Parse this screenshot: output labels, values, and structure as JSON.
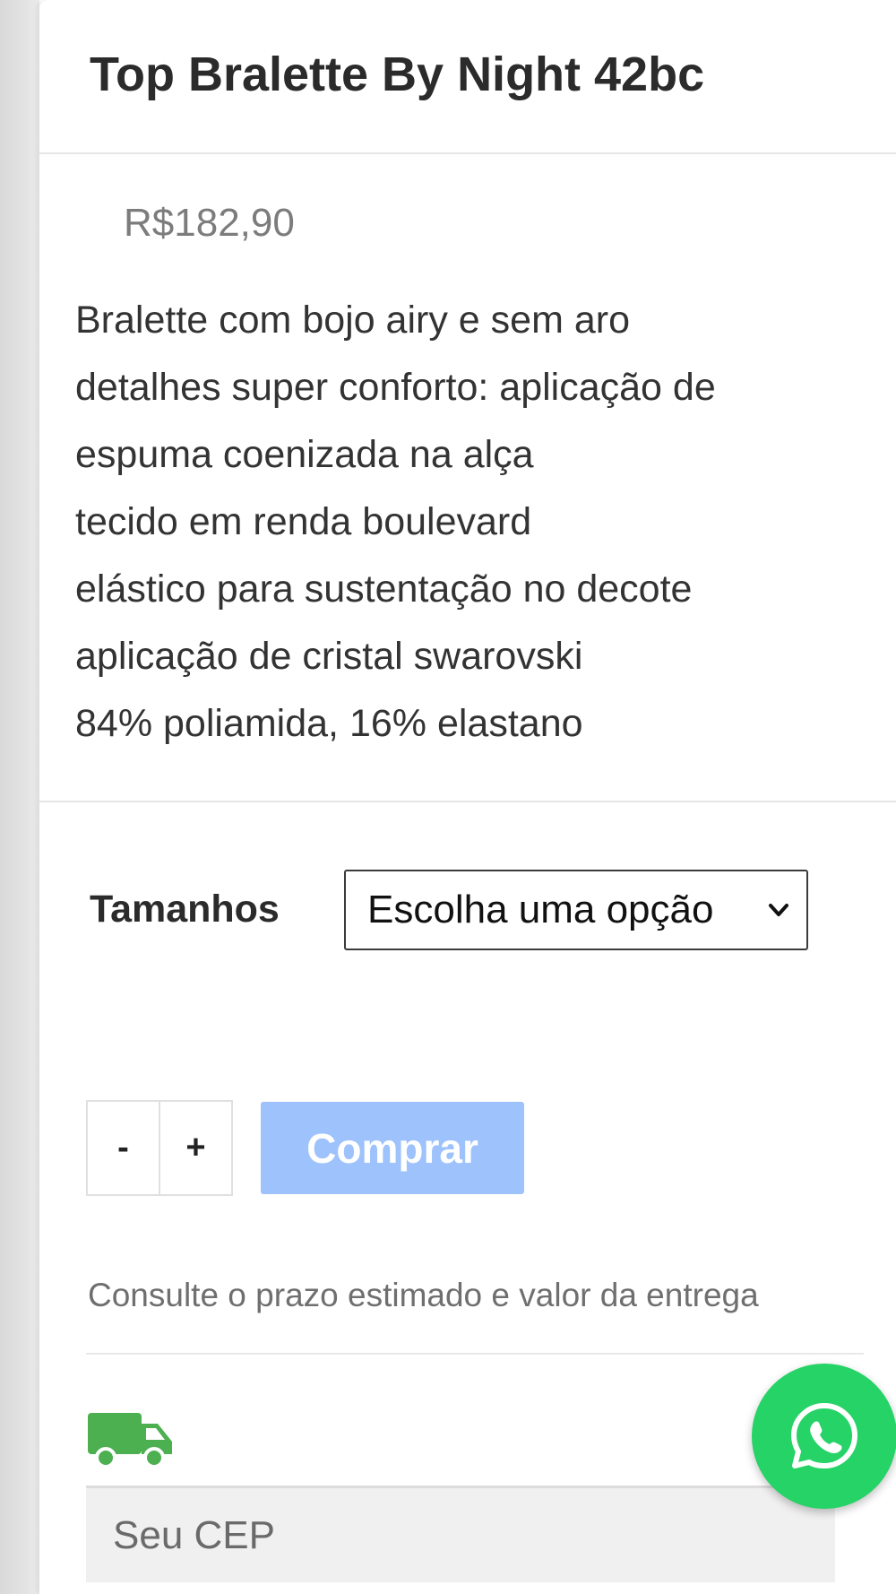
{
  "product": {
    "title": "Top Bralette By Night 42bc",
    "price": "R$182,90",
    "description_lines": [
      "Bralette com bojo airy e sem aro",
      "detalhes super conforto: aplicação de",
      "espuma coenizada na alça",
      "tecido em renda boulevard",
      "elástico para sustentação no decote",
      "aplicação de cristal swarovski",
      "84% poliamida, 16% elastano"
    ]
  },
  "options": {
    "size_label": "Tamanhos",
    "size_select_value": "Escolha uma opção"
  },
  "purchase": {
    "minus_label": "-",
    "plus_label": "+",
    "buy_label": "Comprar",
    "buy_color": "#9ec2fb"
  },
  "shipping": {
    "hint": "Consulte o prazo estimado e valor da entrega",
    "icon": "truck-icon",
    "icon_color": "#4caf50",
    "cep_placeholder": "Seu CEP"
  },
  "whatsapp": {
    "icon": "whatsapp-icon",
    "color": "#25d366"
  }
}
